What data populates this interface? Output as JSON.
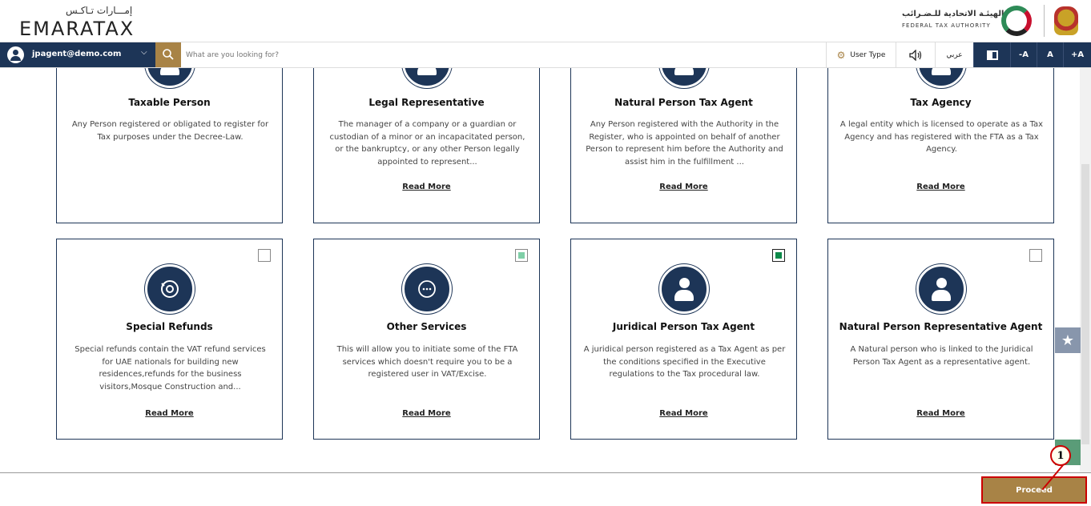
{
  "header": {
    "logo_ar": "إمـــارات تـاكـس",
    "logo_en": "EMARATAX",
    "fta_ar": "الهيئـة الاتحادية للـضـرائب",
    "fta_en": "FEDERAL TAX AUTHORITY"
  },
  "navbar": {
    "user_email": "jpagent@demo.com",
    "search_placeholder": "What are you looking for?",
    "user_type": "User Type",
    "language": "عربي",
    "font_decrease": "-A",
    "font_normal": "A",
    "font_increase": "+A"
  },
  "cards_row1": [
    {
      "title": "Taxable Person",
      "desc": "Any Person registered or obligated to register for Tax purposes under the Decree-Law.",
      "read_more": ""
    },
    {
      "title": "Legal Representative",
      "desc": "The manager of a company or a guardian or custodian of a minor or an incapacitated person, or the bankruptcy, or any other Person legally appointed to represent...",
      "read_more": "Read More"
    },
    {
      "title": "Natural Person Tax Agent",
      "desc": "Any Person registered with the Authority in the Register, who is appointed on behalf of another Person to represent him before the Authority and assist him in the fulfillment ...",
      "read_more": "Read More"
    },
    {
      "title": "Tax Agency",
      "desc": "A legal entity which is licensed to operate as a Tax Agency and has registered with the FTA as a Tax Agency.",
      "read_more": "Read More"
    }
  ],
  "cards_row2": [
    {
      "title": "Special Refunds",
      "desc": "Special refunds contain the VAT refund services for UAE nationals for building new residences,refunds for the business visitors,Mosque Construction and...",
      "read_more": "Read More",
      "checkbox": "unchecked"
    },
    {
      "title": "Other Services",
      "desc": "This will allow you to initiate some of the FTA services which doesn't require you to be a registered user in VAT/Excise.",
      "read_more": "Read More",
      "checkbox": "partial"
    },
    {
      "title": "Juridical Person Tax Agent",
      "desc": "A juridical person registered as a Tax Agent as per the conditions specified in the Executive regulations to the Tax procedural law.",
      "read_more": "Read More",
      "checkbox": "checked"
    },
    {
      "title": "Natural Person Representative Agent",
      "desc": "A Natural person who is linked to the Juridical Person Tax Agent as a representative agent.",
      "read_more": "Read More",
      "checkbox": "unchecked"
    }
  ],
  "footer": {
    "proceed_label": "Proceed",
    "callout_number": "1"
  },
  "colors": {
    "navy": "#1d3557",
    "gold": "#a88346",
    "green_check": "#0d8a4a",
    "callout_red": "#cc0000"
  }
}
